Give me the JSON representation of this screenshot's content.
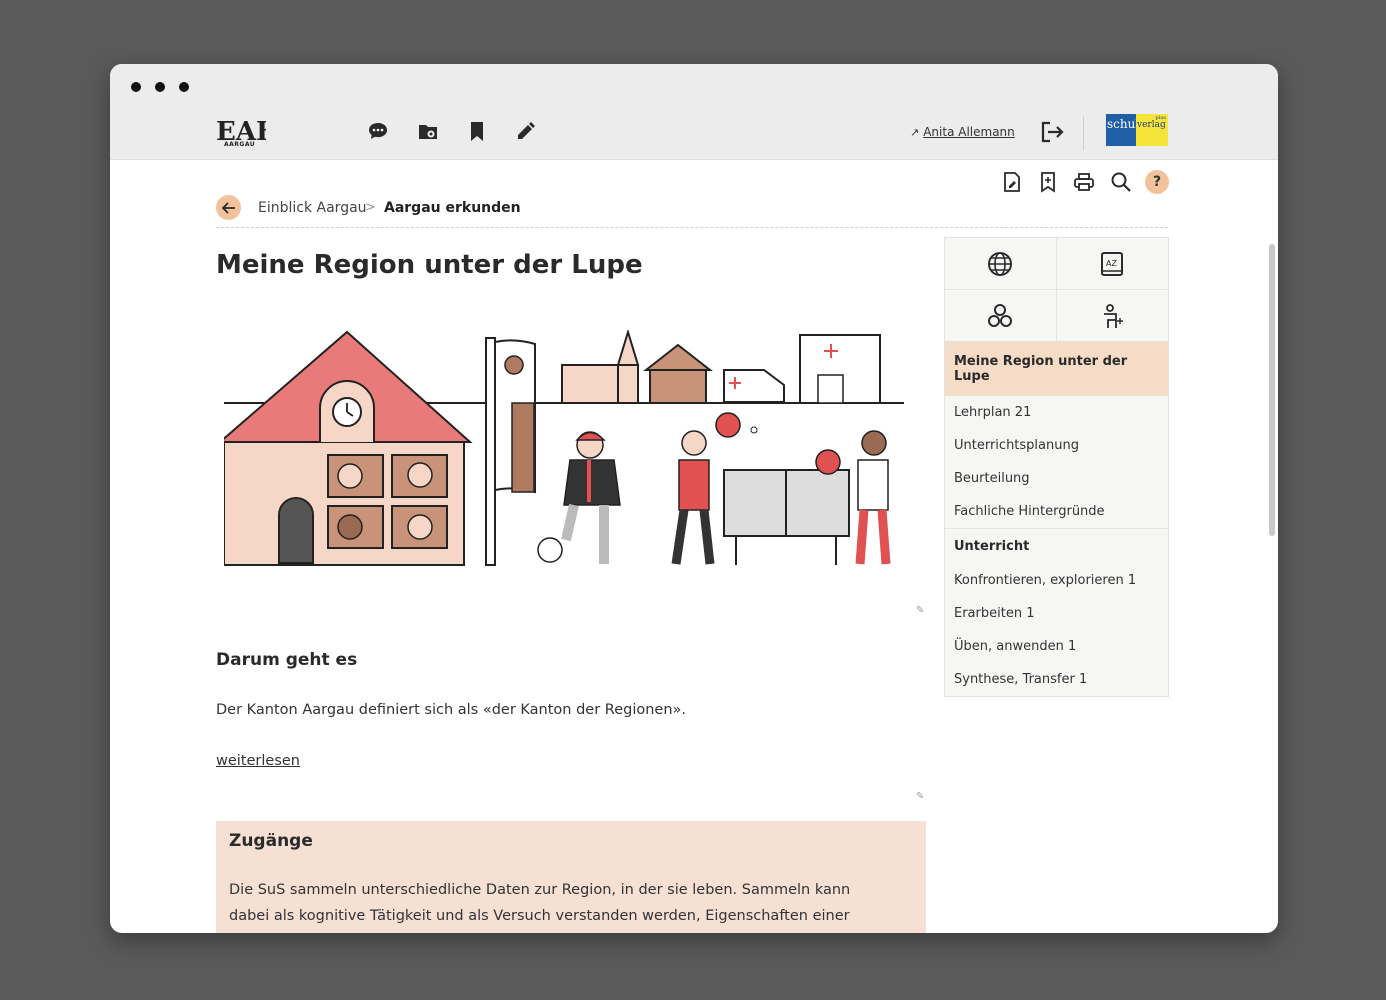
{
  "app": {
    "logo_text": "EAB",
    "logo_subtext": "AARGAU",
    "user_name": "Anita Allemann",
    "user_link_icon": "arrow-up-right-icon",
    "publisher_text_1": "schul",
    "publisher_text_2": "verlag",
    "publisher_text_3": "plus"
  },
  "nav_icons": [
    "chat-icon",
    "folder-gear-icon",
    "bookmark-icon",
    "pencil-icon"
  ],
  "toolbar": {
    "icons": [
      "document-edit-icon",
      "bookmark-add-icon",
      "print-icon",
      "search-icon"
    ],
    "help_label": "?"
  },
  "breadcrumb": {
    "items": [
      "Einblick Aargau",
      "Aargau erkunden"
    ],
    "separator": ">"
  },
  "page": {
    "title": "Meine Region unter der Lupe",
    "section_heading": "Darum geht es",
    "intro": "Der Kanton Aargau definiert sich als «der Kanton der Regionen».",
    "read_more": "weiterlesen",
    "zugang_heading": "Zugänge",
    "zugang_text": "Die SuS sammeln unterschiedliche Daten zur Region, in der sie leben. Sammeln kann dabei als kognitive Tätigkeit und als Versuch verstanden werden, Eigenschaften einer"
  },
  "sidebar": {
    "icon_tiles": [
      "globe-icon",
      "dictionary-icon",
      "circles-icon",
      "teacher-icon"
    ],
    "active": "Meine Region unter der Lupe",
    "items": [
      "Lehrplan 21",
      "Unterrichtsplanung",
      "Beurteilung",
      "Fachliche Hintergründe"
    ],
    "group_label": "Unterricht",
    "group_items": [
      "Konfrontieren, explorieren 1",
      "Erarbeiten 1",
      "Üben, anwenden 1",
      "Synthese, Transfer 1"
    ]
  },
  "colors": {
    "accent_peach": "#f2c39b",
    "highlight_bg": "#f5e0d3",
    "roof_red": "#e87a7a",
    "illus_red": "#e05252"
  }
}
